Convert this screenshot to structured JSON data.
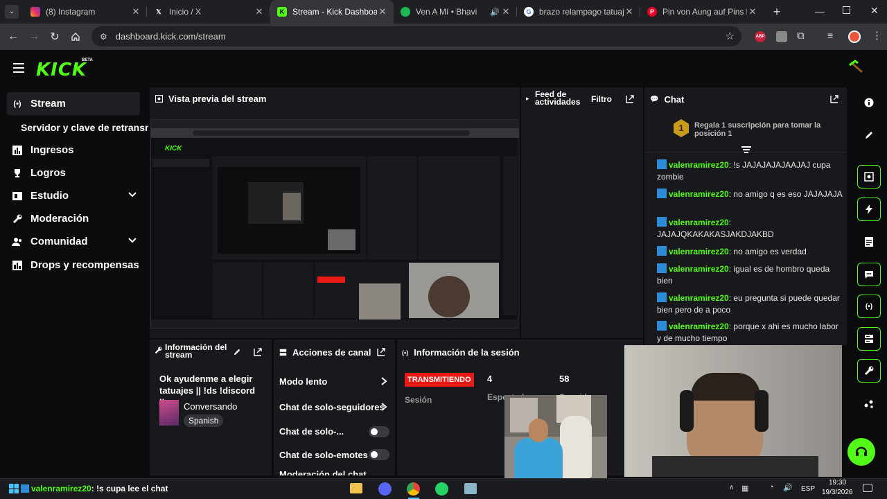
{
  "browser": {
    "tabs": [
      {
        "title": "(8) Instagram",
        "active": false
      },
      {
        "title": "Inicio / X",
        "active": false
      },
      {
        "title": "Stream - Kick Dashboard",
        "active": true
      },
      {
        "title": "Ven A Mí • Bhavi",
        "active": false
      },
      {
        "title": "brazo relampago tatuaje",
        "active": false
      },
      {
        "title": "Pin von Aung auf Pins by y",
        "active": false
      }
    ],
    "url": "dashboard.kick.com/stream",
    "extension_badge": "ABP"
  },
  "header": {
    "logo": "KICK",
    "beta": "BETA"
  },
  "sidebar": {
    "items": [
      {
        "label": "Stream",
        "icon": "broadcast-icon"
      },
      {
        "label": "Servidor y clave de retransmisión",
        "icon": ""
      },
      {
        "label": "Ingresos",
        "icon": "chart-icon"
      },
      {
        "label": "Logros",
        "icon": "trophy-icon"
      },
      {
        "label": "Estudio",
        "icon": "studio-icon"
      },
      {
        "label": "Moderación",
        "icon": "wrench-icon"
      },
      {
        "label": "Comunidad",
        "icon": "community-icon"
      },
      {
        "label": "Drops y recompensas",
        "icon": "gift-icon"
      }
    ]
  },
  "preview": {
    "title": "Vista previa del stream"
  },
  "feed": {
    "title": "Feed de actividades",
    "filter": "Filtro"
  },
  "chat": {
    "title": "Chat",
    "pinned_rank": "1",
    "pinned_text": "Regala 1 suscripción para tomar la posición 1",
    "messages": [
      {
        "user": "valenramirez20",
        "text": ": !s JAJAJAJAJAAJAJ cupa zombie"
      },
      {
        "user": "valenramirez20",
        "text": ": no amigo q es eso JAJAJAJA"
      },
      {
        "user": "valenramirez20",
        "text": ": JAJAJQKAKAKASJAKDJAKBD"
      },
      {
        "user": "valenramirez20",
        "text": ": no amigo es verdad"
      },
      {
        "user": "valenramirez20",
        "text": ": igual es de hombro queda bien"
      },
      {
        "user": "valenramirez20",
        "text": ": eu pregunta si puede quedar bien pero de a poco"
      },
      {
        "user": "valenramirez20",
        "text": ": porque x ahi es mucho labor y de mucho tiempo"
      }
    ]
  },
  "stream_info": {
    "title": "Información del stream",
    "stream_title": "Ok ayudenme a elegir tatuajes || !ds !discord ||...",
    "category": "Conversando",
    "language": "Spanish"
  },
  "channel_actions": {
    "title": "Acciones de canal",
    "items": [
      {
        "label": "Modo lento",
        "type": "chevron"
      },
      {
        "label": "Chat de solo-seguidores",
        "type": "chevron"
      },
      {
        "label": "Chat de solo-...",
        "type": "toggle"
      },
      {
        "label": "Chat de solo-emotes",
        "type": "toggle"
      },
      {
        "label": "Moderación del chat",
        "type": "cut"
      }
    ]
  },
  "session": {
    "title": "Información de la sesión",
    "status": "TRANSMITIENDO",
    "session_label": "Sesión",
    "viewers": "4",
    "viewers_label": "Espectadores",
    "followers": "58",
    "followers_label": "Seguidores"
  },
  "taskbar": {
    "notification_user": "valenramirez20",
    "notification_text": ": !s cupa lee el chat",
    "lang": "ESP",
    "time": "19:30",
    "date": "19/3/2026"
  },
  "colors": {
    "kick_green": "#53fc18",
    "panel_bg": "#18191c",
    "page_bg": "#0b0c0e",
    "live_red": "#e91916"
  }
}
